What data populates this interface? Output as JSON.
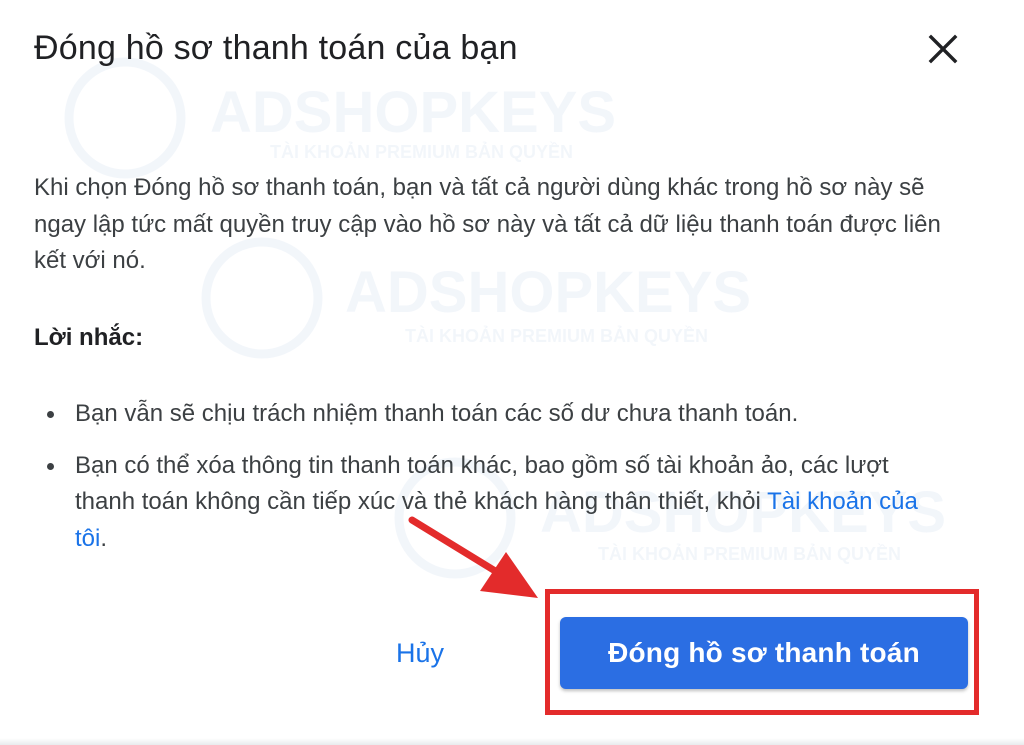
{
  "dialog": {
    "title": "Đóng hồ sơ thanh toán của bạn",
    "close_icon": "close-icon",
    "description": "Khi chọn Đóng hồ sơ thanh toán, bạn và tất cả người dùng khác trong hồ sơ này sẽ ngay lập tức mất quyền truy cập vào hồ sơ này và tất cả dữ liệu thanh toán được liên kết với nó.",
    "reminder_heading": "Lời nhắc:",
    "bullets": [
      {
        "text": "Bạn vẫn sẽ chịu trách nhiệm thanh toán các số dư chưa thanh toán."
      },
      {
        "text": "Bạn có thể xóa thông tin thanh toán khác, bao gồm số tài khoản ảo, các lượt thanh toán không cần tiếp xúc và thẻ khách hàng thân thiết, khỏi ",
        "link": "Tài khoản của tôi",
        "suffix": "."
      }
    ],
    "cancel_label": "Hủy",
    "confirm_label": "Đóng hồ sơ thanh toán"
  },
  "watermark": {
    "brand": "ADSHOPKEYS",
    "tagline": "TÀI KHOẢN PREMIUM BẢN QUYỀN"
  },
  "colors": {
    "primary": "#2b6ee3",
    "link": "#1a73e8",
    "annotation_red": "#e32b2b",
    "text": "#202124"
  }
}
